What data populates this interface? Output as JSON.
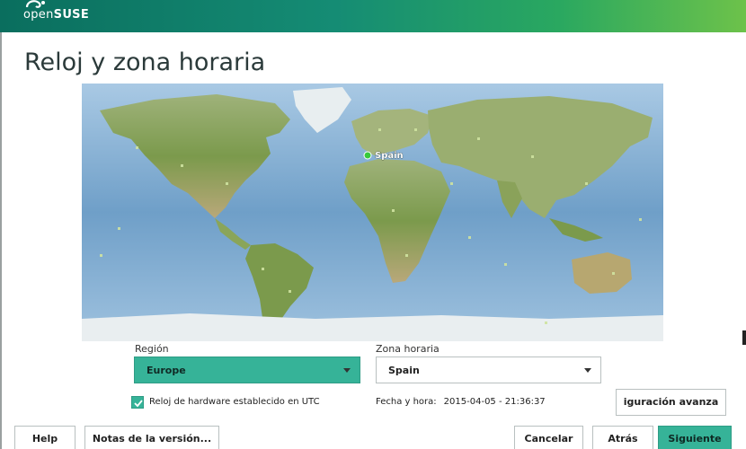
{
  "header": {
    "brand_prefix": "open",
    "brand_suffix": "SUSE",
    "logo_icon": "opensuse-chameleon-icon"
  },
  "page": {
    "title": "Reloj y zona horaria"
  },
  "map": {
    "selected_label": "Spain",
    "marker_color": "#38c93b"
  },
  "region": {
    "label": "Región",
    "value": "Europe"
  },
  "timezone": {
    "label": "Zona horaria",
    "value": "Spain"
  },
  "hardware_clock": {
    "checked": true,
    "label": "Reloj de hardware establecido en UTC"
  },
  "datetime": {
    "label": "Fecha y hora:",
    "value": "2015-04-05 - 21:36:37"
  },
  "buttons": {
    "advanced": "iguración avanza",
    "help": "Help",
    "release_notes": "Notas de la versión...",
    "cancel": "Cancelar",
    "back": "Atrás",
    "next": "Siguiente"
  },
  "colors": {
    "accent": "#36b398",
    "header_start": "#0a6e5e",
    "header_end": "#6dc24a"
  }
}
